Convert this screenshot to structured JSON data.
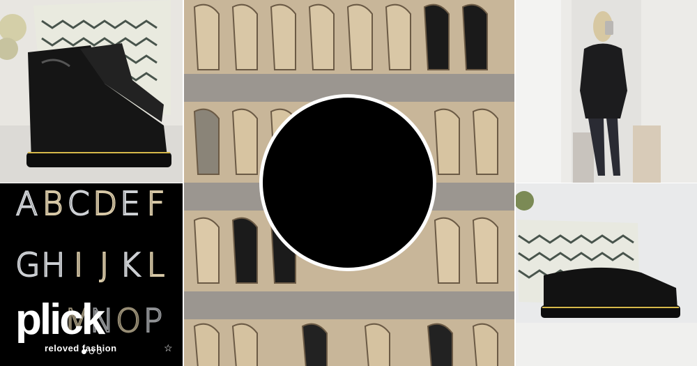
{
  "grid": {
    "letters_tile": {
      "rows": [
        [
          "A",
          "B",
          "C",
          "D",
          "E",
          "F"
        ],
        [
          "G",
          "H",
          "I",
          "J",
          "K",
          "L"
        ],
        [
          "M",
          "N",
          "O",
          "P"
        ]
      ],
      "logo_word": "plick",
      "logo_tagline": "reloved fashion",
      "favorite_icon": "star-icon",
      "carousel_pages": 3,
      "carousel_active": 1
    },
    "colors": {
      "gold": "#d8c9a7",
      "silver": "#cfd2d6",
      "avatar": "#000000"
    }
  }
}
